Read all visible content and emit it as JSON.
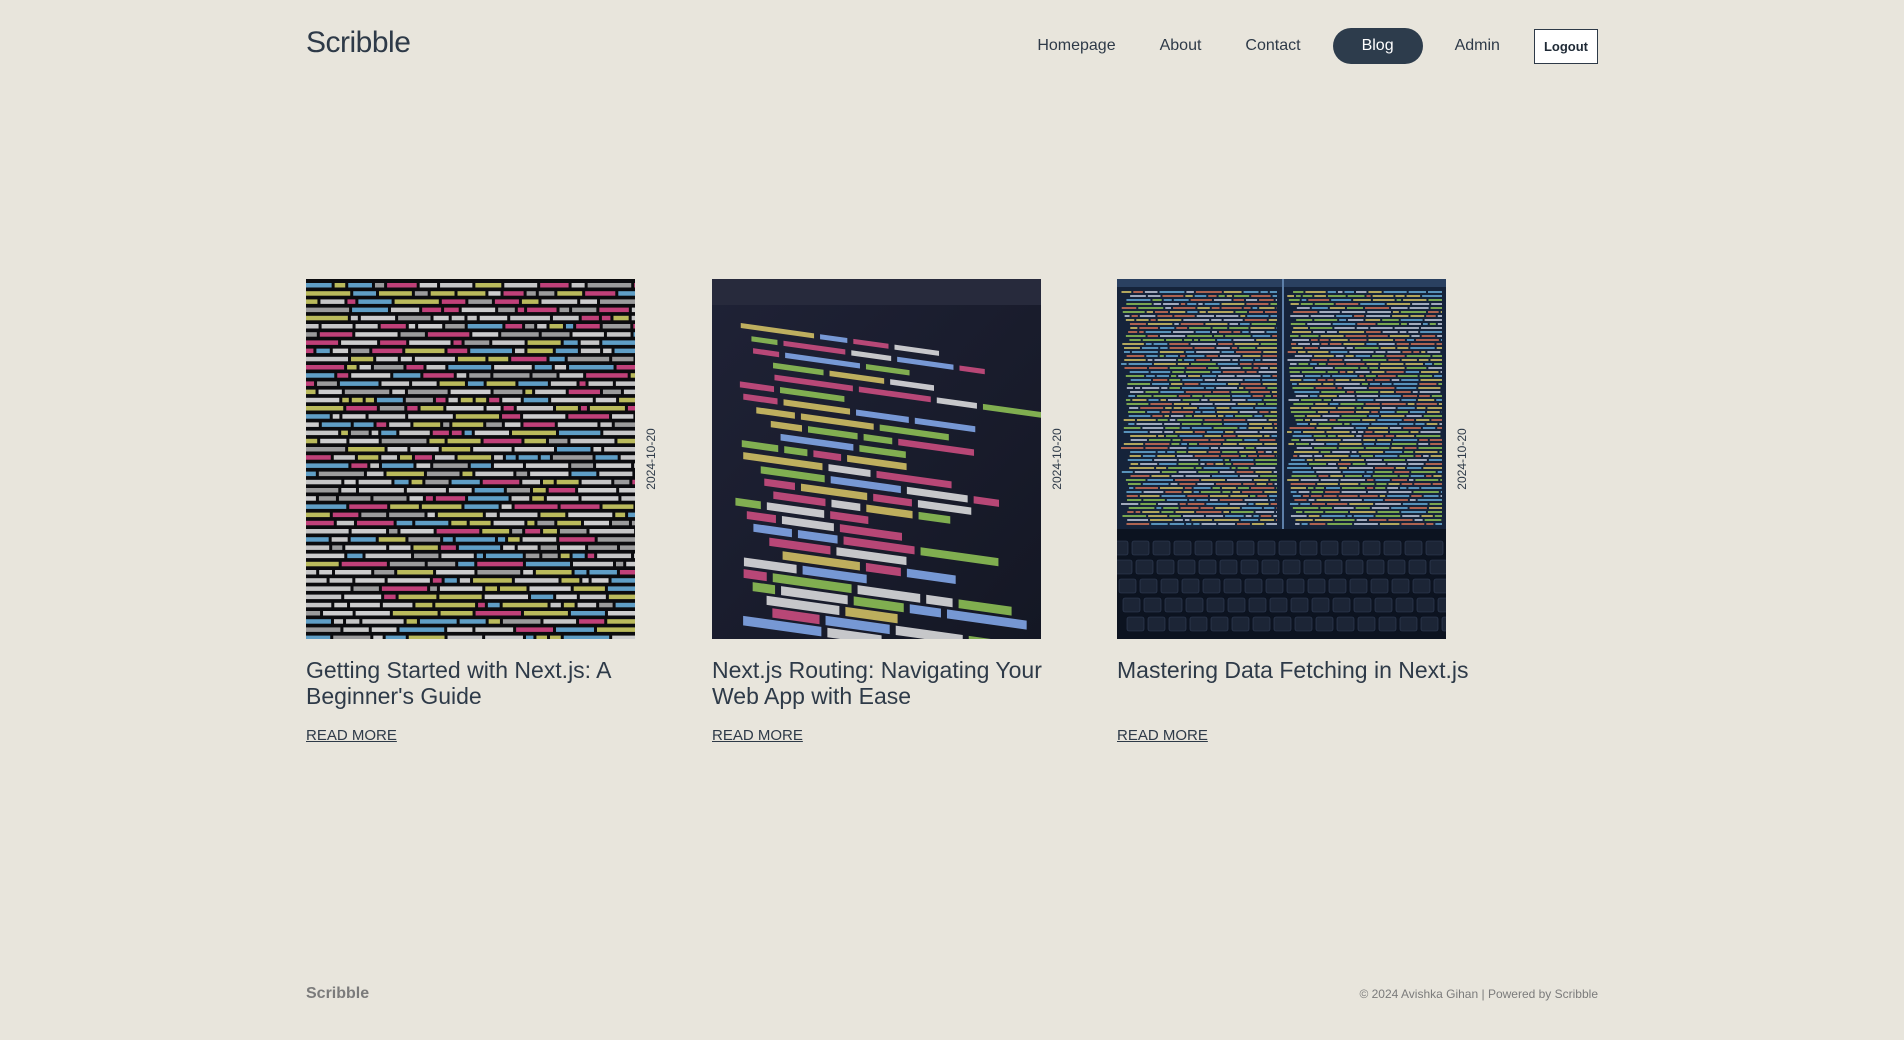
{
  "header": {
    "brand": "Scribble",
    "nav": [
      {
        "label": "Homepage"
      },
      {
        "label": "About"
      },
      {
        "label": "Contact"
      },
      {
        "label": "Blog",
        "active": true
      },
      {
        "label": "Admin"
      }
    ],
    "logout_label": "Logout"
  },
  "posts": [
    {
      "date": "2024-10-20",
      "title": "Getting Started with Next.js: A Beginner's Guide",
      "read_more": "READ MORE",
      "image": "code-screenshot-dark"
    },
    {
      "date": "2024-10-20",
      "title": "Next.js Routing: Navigating Your Web App with Ease",
      "read_more": "READ MORE",
      "image": "html-code-closeup"
    },
    {
      "date": "2024-10-20",
      "title": "Mastering Data Fetching in Next.js",
      "read_more": "READ MORE",
      "image": "laptop-code-screen"
    }
  ],
  "footer": {
    "brand": "Scribble",
    "copyright": "© 2024 Avishka Gihan | Powered by Scribble"
  },
  "colors": {
    "background": "#e8e5dc",
    "text": "#2e3a48",
    "active_nav": "#2d3c4c",
    "muted": "#7b7b7b"
  }
}
